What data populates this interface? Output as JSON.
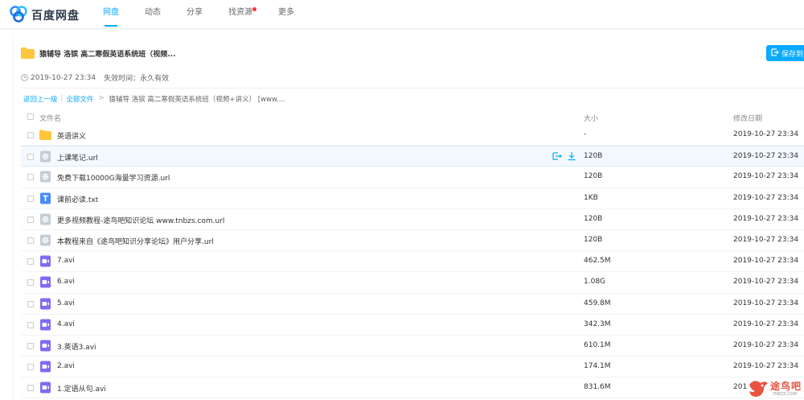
{
  "app": {
    "logo_text": "百度网盘"
  },
  "nav": [
    {
      "label": "网盘",
      "active": true
    },
    {
      "label": "动态",
      "active": false
    },
    {
      "label": "分享",
      "active": false
    },
    {
      "label": "找资源",
      "active": false,
      "badge_dot": true
    },
    {
      "label": "更多",
      "active": false
    }
  ],
  "share": {
    "title": "猿辅导 洛镔 高二寒假英语系统班（视频...",
    "save_button": "保存到",
    "created": "2019-10-27 23:34",
    "expiry_label": "失效时间：永久有效"
  },
  "breadcrumb": {
    "back": "返回上一级",
    "all_files": "全部文件",
    "current": "猿辅导 洛镔 高二寒假英语系统班（视频+讲义） [www...."
  },
  "table": {
    "headers": {
      "name": "文件名",
      "size": "大小",
      "date": "修改日期"
    },
    "rows": [
      {
        "name": "英语讲义",
        "size": "-",
        "date": "2019-10-27 23:34",
        "icon": "folder-icon"
      },
      {
        "name": "上课笔记.url",
        "size": "120B",
        "date": "2019-10-27 23:34",
        "icon": "link-file-icon",
        "hover": true
      },
      {
        "name": "免费下载10000G海量学习资源.url",
        "size": "120B",
        "date": "2019-10-27 23:34",
        "icon": "link-file-icon"
      },
      {
        "name": "课前必读.txt",
        "size": "1KB",
        "date": "2019-10-27 23:34",
        "icon": "text-file-icon"
      },
      {
        "name": "更多视频教程-途鸟吧知识论坛 www.tnbzs.com.url",
        "size": "120B",
        "date": "2019-10-27 23:34",
        "icon": "link-file-icon"
      },
      {
        "name": "本教程来自《途鸟吧知识分享论坛》用户分享.url",
        "size": "120B",
        "date": "2019-10-27 23:34",
        "icon": "link-file-icon"
      },
      {
        "name": "7.avi",
        "size": "462.5M",
        "date": "2019-10-27 23:34",
        "icon": "video-file-icon"
      },
      {
        "name": "6.avi",
        "size": "1.08G",
        "date": "2019-10-27 23:34",
        "icon": "video-file-icon"
      },
      {
        "name": "5.avi",
        "size": "459.8M",
        "date": "2019-10-27 23:34",
        "icon": "video-file-icon"
      },
      {
        "name": "4.avi",
        "size": "342.3M",
        "date": "2019-10-27 23:34",
        "icon": "video-file-icon"
      },
      {
        "name": "3.英语3.avi",
        "size": "610.1M",
        "date": "2019-10-27 23:34",
        "icon": "video-file-icon"
      },
      {
        "name": "2.avi",
        "size": "174.1M",
        "date": "2019-10-27 23:34",
        "icon": "video-file-icon"
      },
      {
        "name": "1.定语从句.avi",
        "size": "831.6M",
        "date": "201",
        "icon": "video-file-icon"
      }
    ]
  },
  "watermark": {
    "text": "途鸟吧",
    "sub": "TNBZS.COM"
  },
  "colors": {
    "accent": "#09aaff",
    "folder": "#ffc53d",
    "video": "#7d6cf4",
    "text_file": "#4a8cf7",
    "link_file": "#c4ccd6"
  }
}
